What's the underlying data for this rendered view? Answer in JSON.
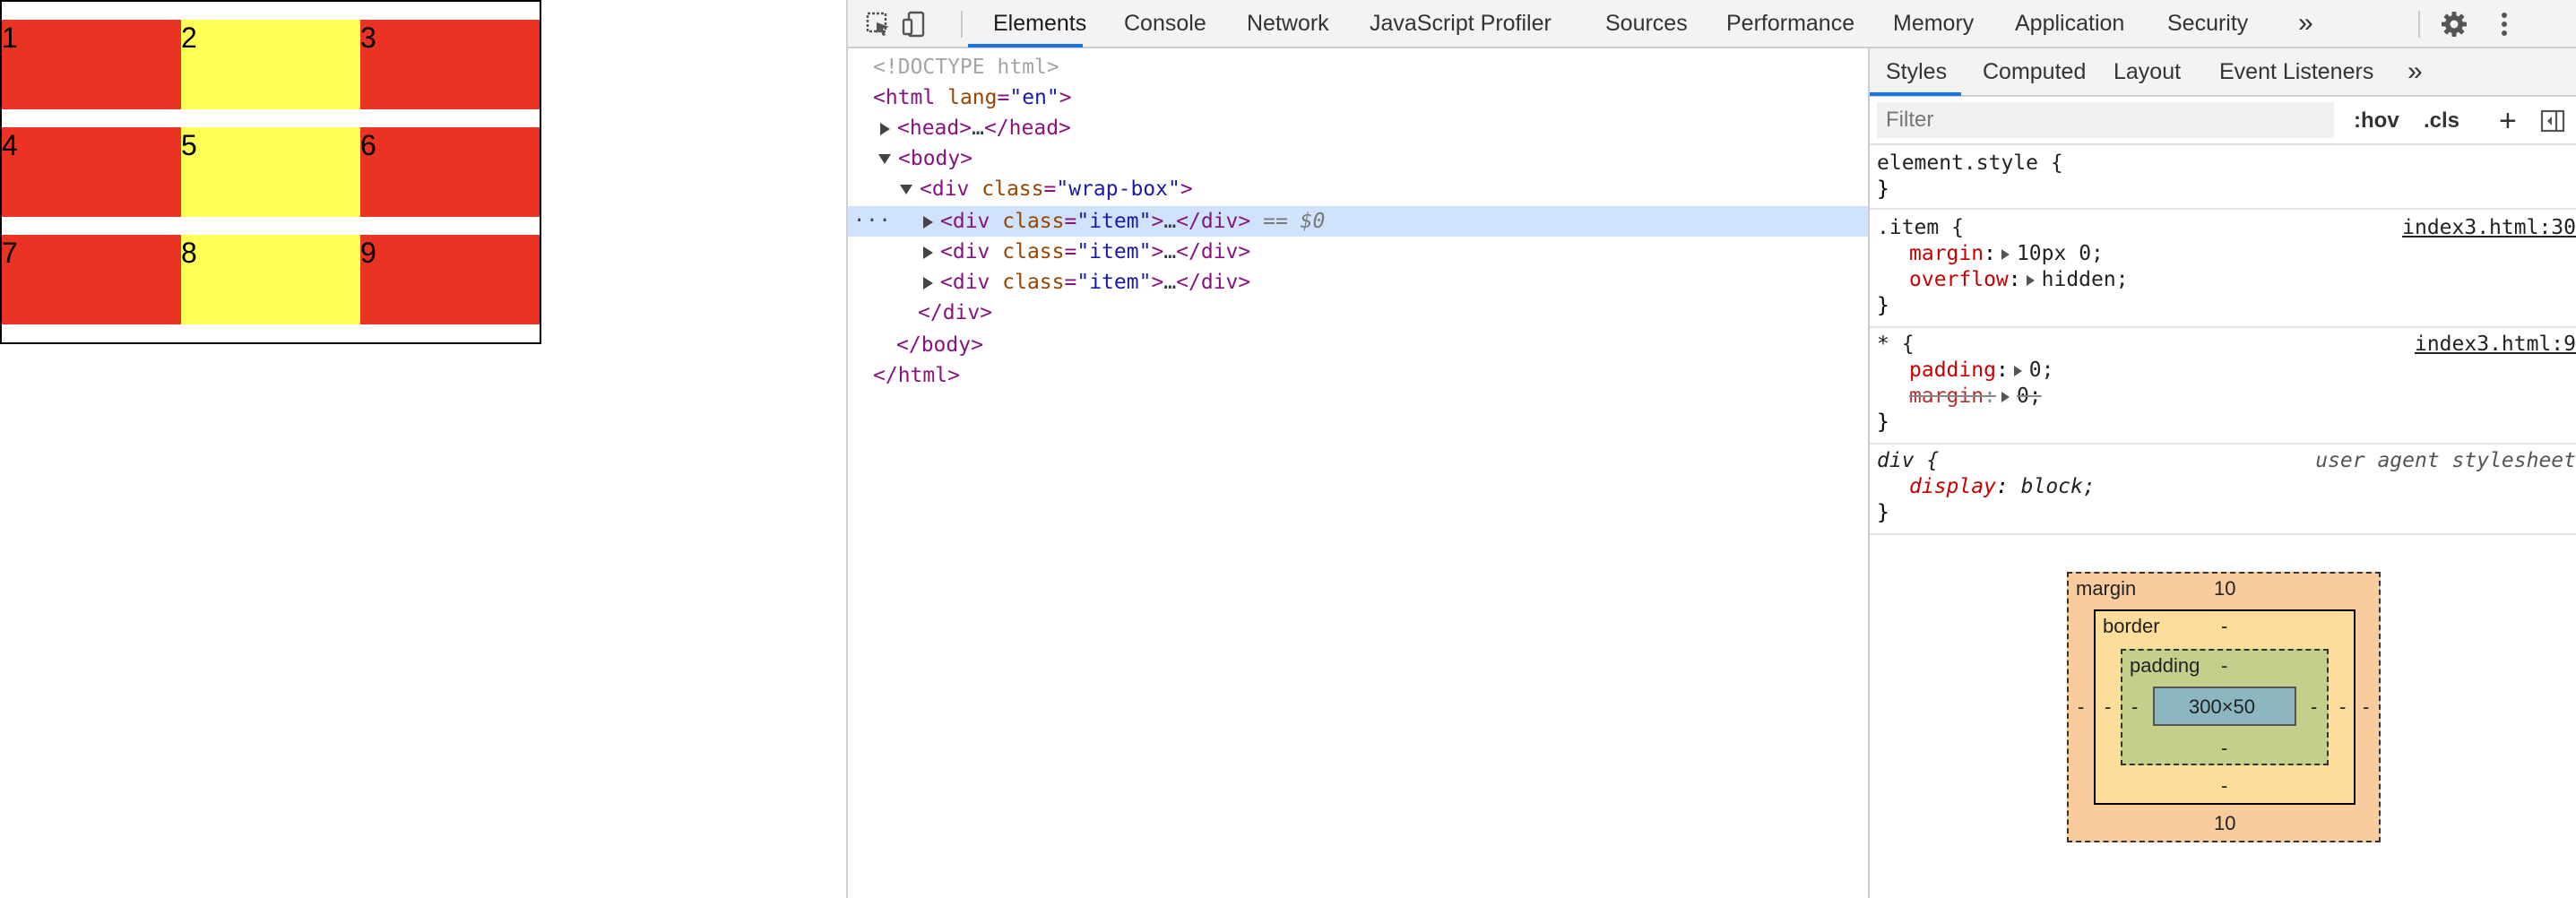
{
  "page": {
    "rows": [
      {
        "cells": [
          "1",
          "2",
          "3"
        ]
      },
      {
        "cells": [
          "4",
          "5",
          "6"
        ]
      },
      {
        "cells": [
          "7",
          "8",
          "9"
        ]
      }
    ],
    "colors": {
      "red": "#ea3323",
      "yellow": "#ffff55",
      "border": "#000000"
    }
  },
  "devtools": {
    "toolbar": {
      "icons": [
        "inspect-element-icon",
        "device-toggle-icon",
        "more-tabs-icon",
        "settings-gear-icon",
        "kebab-menu-icon"
      ],
      "tabs": [
        "Elements",
        "Console",
        "Network",
        "JavaScript Profiler",
        "Sources",
        "Performance",
        "Memory",
        "Application",
        "Security"
      ],
      "more": "»",
      "active_tab": "Elements"
    },
    "dom": {
      "doctype": "<!DOCTYPE html>",
      "html_open_tag": "<html",
      "html_attr": "lang",
      "html_attr_val": "\"en\"",
      "close_bracket": ">",
      "head": "<head>",
      "ellipsis": "…",
      "head_close": "</head>",
      "body_open": "<body>",
      "div_open": "<div",
      "attr_class": "class",
      "eq": "=",
      "wrapbox_val": "\"wrap-box\"",
      "item_val": "\"item\"",
      "div_close": "</div>",
      "selected_ref": "== $0",
      "selected_dots": "···",
      "body_close": "</body>",
      "html_close": "</html>"
    },
    "styles": {
      "tabs": [
        "Styles",
        "Computed",
        "Layout",
        "Event Listeners"
      ],
      "more": "»",
      "filter_placeholder": "Filter",
      "hov": ":hov",
      "cls": ".cls",
      "plus": "+",
      "element_style": "element.style {",
      "close_brace": "}",
      "rule_item_selector": ".item {",
      "rule_item_source": "index3.html:30",
      "rule_item_props": [
        {
          "name": "margin",
          "value": "10px 0;"
        },
        {
          "name": "overflow",
          "value": "hidden;"
        }
      ],
      "rule_star_selector": "* {",
      "rule_star_source": "index3.html:9",
      "rule_star_props": [
        {
          "name": "padding",
          "value": "0;"
        },
        {
          "name": "margin",
          "value": "0;"
        }
      ],
      "rule_div_selector": "div {",
      "rule_div_source": "user agent stylesheet",
      "rule_div_props": [
        {
          "name": "display",
          "value": "block;"
        }
      ]
    },
    "box_model": {
      "margin_label": "margin",
      "margin_top": "10",
      "margin_bottom": "10",
      "margin_left": "-",
      "margin_right": "-",
      "border_label": "border",
      "border_top": "-",
      "border_bottom": "-",
      "border_left": "-",
      "border_right": "-",
      "padding_label": "padding",
      "padding_top": "-",
      "padding_bottom": "-",
      "padding_left": "-",
      "padding_right": "-",
      "content": "300×50"
    }
  }
}
